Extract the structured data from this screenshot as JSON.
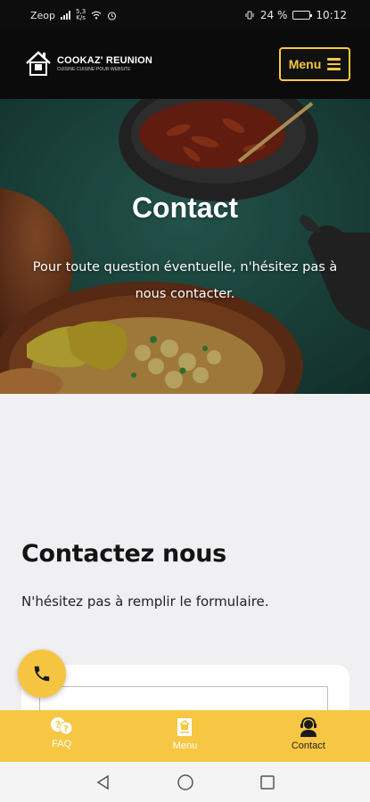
{
  "status_bar": {
    "carrier": "Zeop",
    "network_speed": "5,3",
    "network_unit": "K/s",
    "battery": "24 %",
    "time": "10:12"
  },
  "header": {
    "logo_name": "COOKAZ' REUNION",
    "logo_tagline": "CUISINE·CUISINE·POUR·WEBSITE",
    "menu_label": "Menu"
  },
  "hero": {
    "title": "Contact",
    "text": "Pour toute question éventuelle, n'hésitez pas à nous contacter."
  },
  "section": {
    "title": "Contactez nous",
    "subtitle": "N'hésitez pas à remplir le formulaire."
  },
  "bottom_nav": {
    "items": [
      {
        "label": "FAQ",
        "icon": "question-bubbles-icon"
      },
      {
        "label": "Menu",
        "icon": "menu-card-icon"
      },
      {
        "label": "Contact",
        "icon": "support-agent-icon",
        "active": true
      }
    ]
  },
  "colors": {
    "accent": "#f7c744",
    "header_bg": "#0b0b0b",
    "section_bg": "#f0f0f2"
  }
}
